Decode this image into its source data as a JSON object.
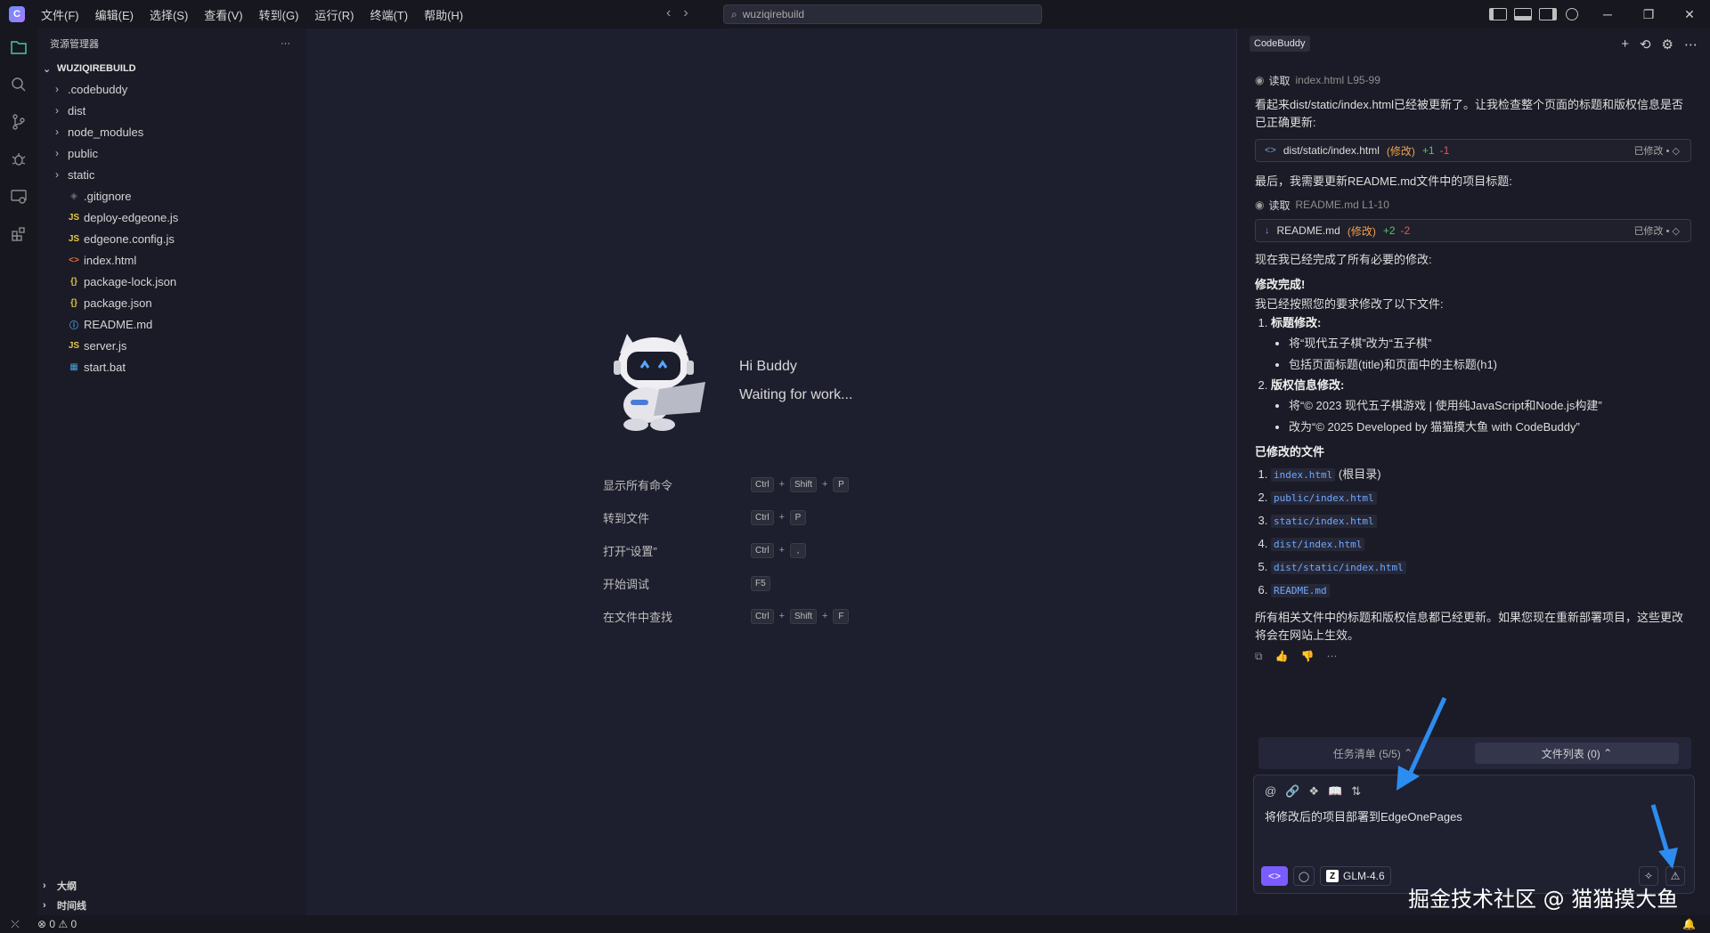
{
  "menu": [
    "文件(F)",
    "编辑(E)",
    "选择(S)",
    "查看(V)",
    "转到(G)",
    "运行(R)",
    "终端(T)",
    "帮助(H)"
  ],
  "search": {
    "value": "wuziqirebuild"
  },
  "explorer": {
    "title": "资源管理器",
    "more": "···",
    "root": "WUZIQIREBUILD",
    "items": [
      {
        "label": ".codebuddy",
        "type": "folder"
      },
      {
        "label": "dist",
        "type": "folder"
      },
      {
        "label": "node_modules",
        "type": "folder"
      },
      {
        "label": "public",
        "type": "folder"
      },
      {
        "label": "static",
        "type": "folder"
      },
      {
        "label": ".gitignore",
        "type": "git",
        "icon": "◈"
      },
      {
        "label": "deploy-edgeone.js",
        "type": "js",
        "icon": "JS"
      },
      {
        "label": "edgeone.config.js",
        "type": "js",
        "icon": "JS"
      },
      {
        "label": "index.html",
        "type": "html",
        "icon": "<>"
      },
      {
        "label": "package-lock.json",
        "type": "json",
        "icon": "{}"
      },
      {
        "label": "package.json",
        "type": "json",
        "icon": "{}"
      },
      {
        "label": "README.md",
        "type": "info",
        "icon": "ⓘ"
      },
      {
        "label": "server.js",
        "type": "js",
        "icon": "JS"
      },
      {
        "label": "start.bat",
        "type": "bat",
        "icon": "▦"
      }
    ],
    "outline": "大纲",
    "timeline": "时间线"
  },
  "welcome": {
    "hi": "Hi Buddy",
    "waiting": "Waiting for work...",
    "shortcuts": [
      {
        "label": "显示所有命令",
        "keys": [
          "Ctrl",
          "Shift",
          "P"
        ]
      },
      {
        "label": "转到文件",
        "keys": [
          "Ctrl",
          "P"
        ]
      },
      {
        "label": "打开“设置”",
        "keys": [
          "Ctrl",
          ","
        ]
      },
      {
        "label": "开始调试",
        "keys": [
          "F5"
        ]
      },
      {
        "label": "在文件中查找",
        "keys": [
          "Ctrl",
          "Shift",
          "F"
        ]
      }
    ]
  },
  "panel": {
    "tag": "CodeBuddy",
    "read1": {
      "verb": "读取",
      "file": "index.html L95-99"
    },
    "p1": "看起来dist/static/index.html已经被更新了。让我检查整个页面的标题和版权信息是否已正确更新:",
    "card1": {
      "file": "dist/static/index.html",
      "mod": "(修改)",
      "add": "+1",
      "del": "-1",
      "status": "已修改 • ◇"
    },
    "p2": "最后，我需要更新README.md文件中的项目标题:",
    "read2": {
      "verb": "读取",
      "file": "README.md L1-10"
    },
    "card2": {
      "file": "README.md",
      "mod": "(修改)",
      "add": "+2",
      "del": "-2",
      "status": "已修改 • ◇"
    },
    "p3": "现在我已经完成了所有必要的修改:",
    "done_title": "修改完成!",
    "p4": "我已经按照您的要求修改了以下文件:",
    "changes": [
      {
        "title": "标题修改:",
        "subs": [
          "将“现代五子棋”改为“五子棋”",
          "包括页面标题(title)和页面中的主标题(h1)"
        ]
      },
      {
        "title": "版权信息修改:",
        "subs": [
          "将“© 2023 现代五子棋游戏 | 使用纯JavaScript和Node.js构建”",
          "改为“© 2025 Developed by 猫猫摸大鱼 with CodeBuddy”"
        ]
      }
    ],
    "files_title": "已修改的文件",
    "files": [
      {
        "code": "index.html",
        "note": "(根目录)"
      },
      {
        "code": "public/index.html",
        "note": ""
      },
      {
        "code": "static/index.html",
        "note": ""
      },
      {
        "code": "dist/index.html",
        "note": ""
      },
      {
        "code": "dist/static/index.html",
        "note": ""
      },
      {
        "code": "README.md",
        "note": ""
      }
    ],
    "p5": "所有相关文件中的标题和版权信息都已经更新。如果您现在重新部署项目，这些更改将会在网站上生效。",
    "tab_tasks": "任务清单 (5/5)",
    "tab_files": "文件列表 (0)",
    "input_value": "将修改后的项目部署到EdgeOnePages",
    "model": "GLM-4.6"
  },
  "watermark": "掘金技术社区 @ 猫猫摸大鱼",
  "status": {
    "problems": "⊗ 0 ⚠ 0"
  },
  "colors": {
    "accent": "#7b5cff",
    "arrow": "#2d8cf0",
    "active_icon": "#4fc3a1"
  }
}
